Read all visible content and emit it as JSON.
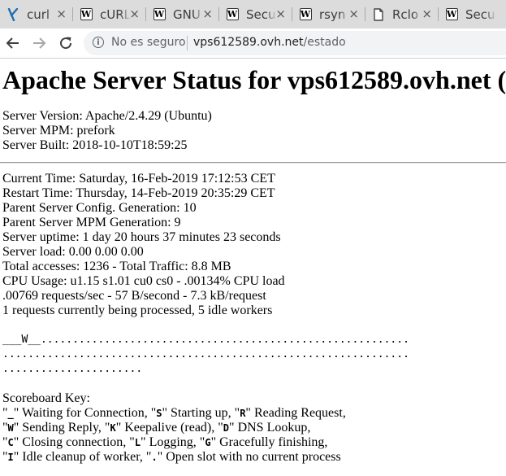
{
  "browser": {
    "tabs": [
      {
        "icon": "curl-icon",
        "label": "curl"
      },
      {
        "icon": "wikipedia-icon",
        "label": "cURL"
      },
      {
        "icon": "wikipedia-icon",
        "label": "GNU"
      },
      {
        "icon": "wikipedia-icon",
        "label": "Secu"
      },
      {
        "icon": "wikipedia-icon",
        "label": "rsyn"
      },
      {
        "icon": "document-icon",
        "label": "Rclo"
      },
      {
        "icon": "wikipedia-icon",
        "label": "Secu"
      }
    ],
    "favicon_letter": "W",
    "close_glyph": "×",
    "address": {
      "insecure_label": "No es seguro",
      "host": "vps612589.ovh.net",
      "path": "/estado"
    }
  },
  "page": {
    "title": "Apache Server Status for vps612589.ovh.net (",
    "server_info": [
      "Server Version: Apache/2.4.29 (Ubuntu)",
      "Server MPM: prefork",
      "Server Built: 2018-10-10T18:59:25"
    ],
    "status": [
      "Current Time: Saturday, 16-Feb-2019 17:12:53 CET",
      "Restart Time: Thursday, 14-Feb-2019 20:35:29 CET",
      "Parent Server Config. Generation: 10",
      "Parent Server MPM Generation: 9",
      "Server uptime: 1 day 20 hours 37 minutes 23 seconds",
      "Server load: 0.00 0.00 0.00",
      "Total accesses: 1236 - Total Traffic: 8.8 MB",
      "CPU Usage: u1.15 s1.01 cu0 cs0 - .00134% CPU load",
      ".00769 requests/sec - 57 B/second - 7.3 kB/request",
      "1 requests currently being processed, 5 idle workers"
    ],
    "scoreboard": [
      "___W__..........................................................",
      "................................................................",
      "......................"
    ],
    "key_title": "Scoreboard Key:",
    "key_lines": [
      [
        {
          "t": "\""
        },
        {
          "c": "_"
        },
        {
          "t": "\" Waiting for Connection, \""
        },
        {
          "c": "S"
        },
        {
          "t": "\" Starting up, \""
        },
        {
          "c": "R"
        },
        {
          "t": "\" Reading Request,"
        }
      ],
      [
        {
          "t": "\""
        },
        {
          "c": "W"
        },
        {
          "t": "\" Sending Reply, \""
        },
        {
          "c": "K"
        },
        {
          "t": "\" Keepalive (read), \""
        },
        {
          "c": "D"
        },
        {
          "t": "\" DNS Lookup,"
        }
      ],
      [
        {
          "t": "\""
        },
        {
          "c": "C"
        },
        {
          "t": "\" Closing connection, \""
        },
        {
          "c": "L"
        },
        {
          "t": "\" Logging, \""
        },
        {
          "c": "G"
        },
        {
          "t": "\" Gracefully finishing,"
        }
      ],
      [
        {
          "t": "\""
        },
        {
          "c": "I"
        },
        {
          "t": "\" Idle cleanup of worker, \""
        },
        {
          "c": "."
        },
        {
          "t": "\" Open slot with no current process"
        }
      ]
    ]
  }
}
